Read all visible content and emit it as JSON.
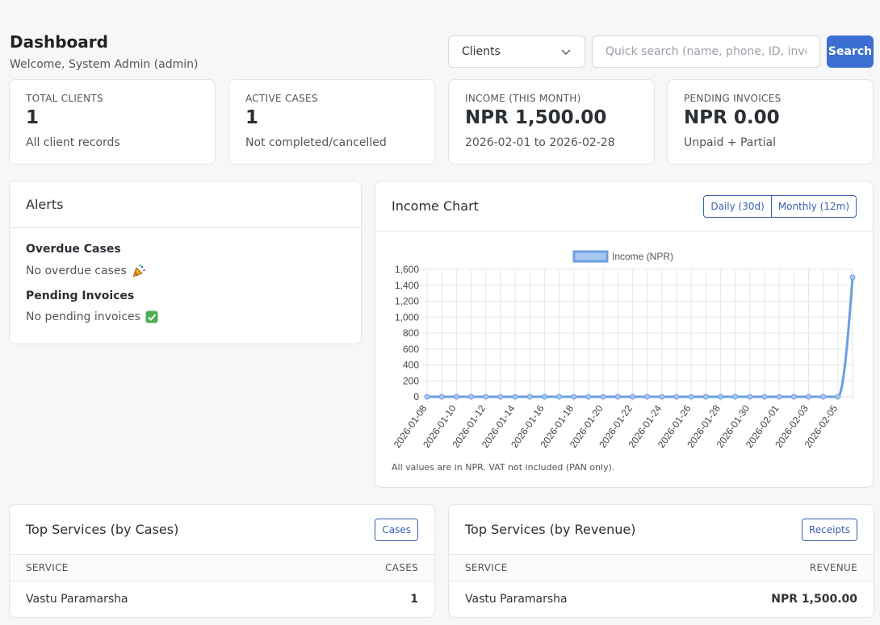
{
  "header": {
    "title": "Dashboard",
    "subtitle": "Welcome, System Admin (admin)"
  },
  "search": {
    "select_value": "Clients",
    "placeholder": "Quick search (name, phone, ID, invoice…)",
    "button_label": "Search"
  },
  "stats": [
    {
      "label": "TOTAL CLIENTS",
      "value": "1",
      "sub": "All client records"
    },
    {
      "label": "ACTIVE CASES",
      "value": "1",
      "sub": "Not completed/cancelled"
    },
    {
      "label": "INCOME (THIS MONTH)",
      "value": "NPR 1,500.00",
      "sub": "2026-02-01 to 2026-02-28"
    },
    {
      "label": "PENDING INVOICES",
      "value": "NPR 0.00",
      "sub": "Unpaid + Partial"
    }
  ],
  "alerts": {
    "title": "Alerts",
    "overdue_heading": "Overdue Cases",
    "overdue_text": "No overdue cases",
    "overdue_icon": "party-popper-icon",
    "pending_heading": "Pending Invoices",
    "pending_text": "No pending invoices",
    "pending_icon": "check-mark-icon"
  },
  "income_chart": {
    "title": "Income Chart",
    "btn_daily": "Daily (30d)",
    "btn_monthly": "Monthly (12m)",
    "note": "All values are in NPR. VAT not included (PAN only)."
  },
  "chart_data": {
    "type": "line",
    "legend": [
      "Income (NPR)"
    ],
    "legend_position": "top",
    "grid": true,
    "ylim": [
      0,
      1600
    ],
    "yticks": [
      "0",
      "200",
      "400",
      "600",
      "800",
      "1,000",
      "1,200",
      "1,400",
      "1,600"
    ],
    "x": [
      "2026-01-08",
      "2026-01-09",
      "2026-01-10",
      "2026-01-11",
      "2026-01-12",
      "2026-01-13",
      "2026-01-14",
      "2026-01-15",
      "2026-01-16",
      "2026-01-17",
      "2026-01-18",
      "2026-01-19",
      "2026-01-20",
      "2026-01-21",
      "2026-01-22",
      "2026-01-23",
      "2026-01-24",
      "2026-01-25",
      "2026-01-26",
      "2026-01-27",
      "2026-01-28",
      "2026-01-29",
      "2026-01-30",
      "2026-01-31",
      "2026-02-01",
      "2026-02-02",
      "2026-02-03",
      "2026-02-04",
      "2026-02-05",
      "2026-02-06"
    ],
    "xtick_labels": [
      "2026-01-08",
      "2026-01-10",
      "2026-01-12",
      "2026-01-14",
      "2026-01-16",
      "2026-01-18",
      "2026-01-20",
      "2026-01-22",
      "2026-01-24",
      "2026-01-26",
      "2026-01-28",
      "2026-01-30",
      "2026-02-01",
      "2026-02-03",
      "2026-02-05"
    ],
    "series": [
      {
        "name": "Income (NPR)",
        "values": [
          0,
          0,
          0,
          0,
          0,
          0,
          0,
          0,
          0,
          0,
          0,
          0,
          0,
          0,
          0,
          0,
          0,
          0,
          0,
          0,
          0,
          0,
          0,
          0,
          0,
          0,
          0,
          0,
          0,
          1500
        ]
      }
    ],
    "colors": {
      "line": "#6a9fe0",
      "fill": "#a9c7f0"
    }
  },
  "top_cases": {
    "title": "Top Services (by Cases)",
    "button": "Cases",
    "col_service": "SERVICE",
    "col_value": "CASES",
    "rows": [
      {
        "service": "Vastu Paramarsha",
        "value": "1"
      }
    ]
  },
  "top_revenue": {
    "title": "Top Services (by Revenue)",
    "button": "Receipts",
    "col_service": "SERVICE",
    "col_value": "REVENUE",
    "rows": [
      {
        "service": "Vastu Paramarsha",
        "value": "NPR 1,500.00"
      }
    ]
  }
}
